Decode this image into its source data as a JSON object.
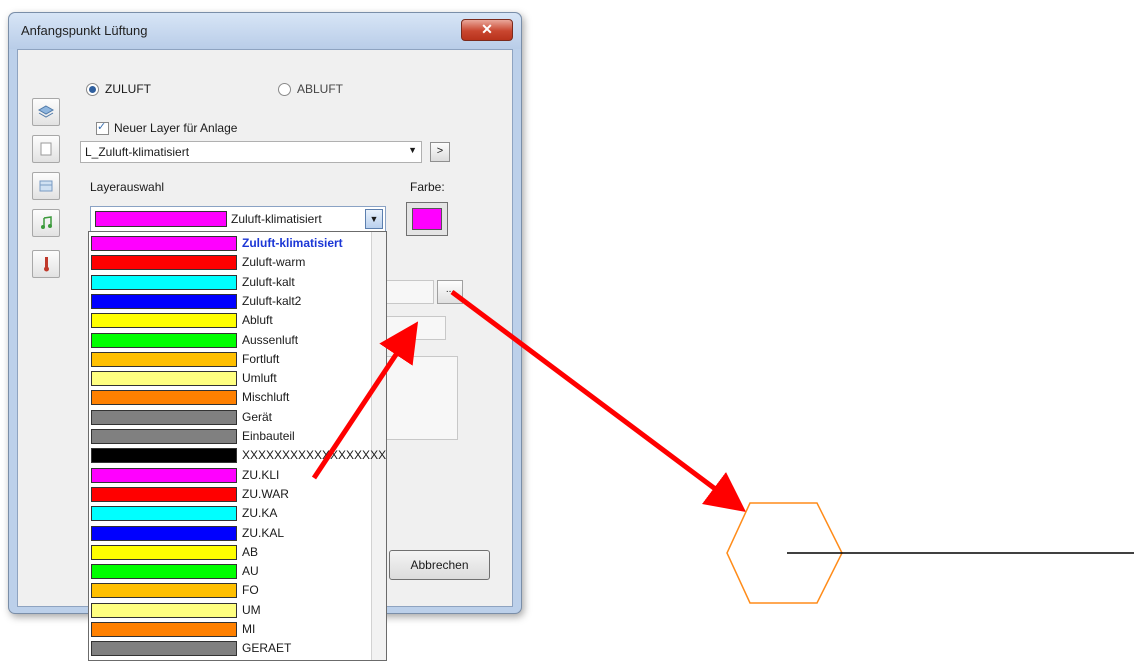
{
  "dialog": {
    "title": "Anfangspunkt Lüftung",
    "close_glyph": "✕",
    "radio_zuluft": "ZULUFT",
    "radio_abluft": "ABLUFT",
    "checkbox_label": "Neuer Layer für Anlage",
    "layer_combo_value": "L_Zuluft-klimatisiert",
    "small_button": ">",
    "layerauswahl_label": "Layerauswahl",
    "farbe_label": "Farbe:",
    "selected_layer": "Zuluft-klimatisiert",
    "ellipsis_button": "...",
    "cancel_button": "Abbrechen",
    "selected_color": "#ff00ff"
  },
  "layers": [
    {
      "name": "Zuluft-klimatisiert",
      "color": "#ff00ff"
    },
    {
      "name": "Zuluft-warm",
      "color": "#ff0000"
    },
    {
      "name": "Zuluft-kalt",
      "color": "#00ffff"
    },
    {
      "name": "Zuluft-kalt2",
      "color": "#0000ff"
    },
    {
      "name": "Abluft",
      "color": "#ffff00"
    },
    {
      "name": "Aussenluft",
      "color": "#00ff00"
    },
    {
      "name": "Fortluft",
      "color": "#ffbf00"
    },
    {
      "name": "Umluft",
      "color": "#ffff80"
    },
    {
      "name": "Mischluft",
      "color": "#ff8000"
    },
    {
      "name": "Gerät",
      "color": "#808080"
    },
    {
      "name": "Einbauteil",
      "color": "#808080"
    },
    {
      "name": "XXXXXXXXXXXXXXXXXXX",
      "color": "#000000"
    },
    {
      "name": "ZU.KLI",
      "color": "#ff00ff"
    },
    {
      "name": "ZU.WAR",
      "color": "#ff0000"
    },
    {
      "name": "ZU.KA",
      "color": "#00ffff"
    },
    {
      "name": "ZU.KAL",
      "color": "#0000ff"
    },
    {
      "name": "AB",
      "color": "#ffff00"
    },
    {
      "name": "AU",
      "color": "#00ff00"
    },
    {
      "name": "FO",
      "color": "#ffbf00"
    },
    {
      "name": "UM",
      "color": "#ffff80"
    },
    {
      "name": "MI",
      "color": "#ff8000"
    },
    {
      "name": "GERAET",
      "color": "#808080"
    }
  ],
  "toolbar_icons": [
    "layers-icon",
    "document-icon",
    "table-icon",
    "music-note-icon",
    "thermometer-icon"
  ],
  "annotations": {
    "arrow_color": "#ff0000",
    "hexagon_color": "#ff8c1a",
    "line_color": "#000000"
  }
}
